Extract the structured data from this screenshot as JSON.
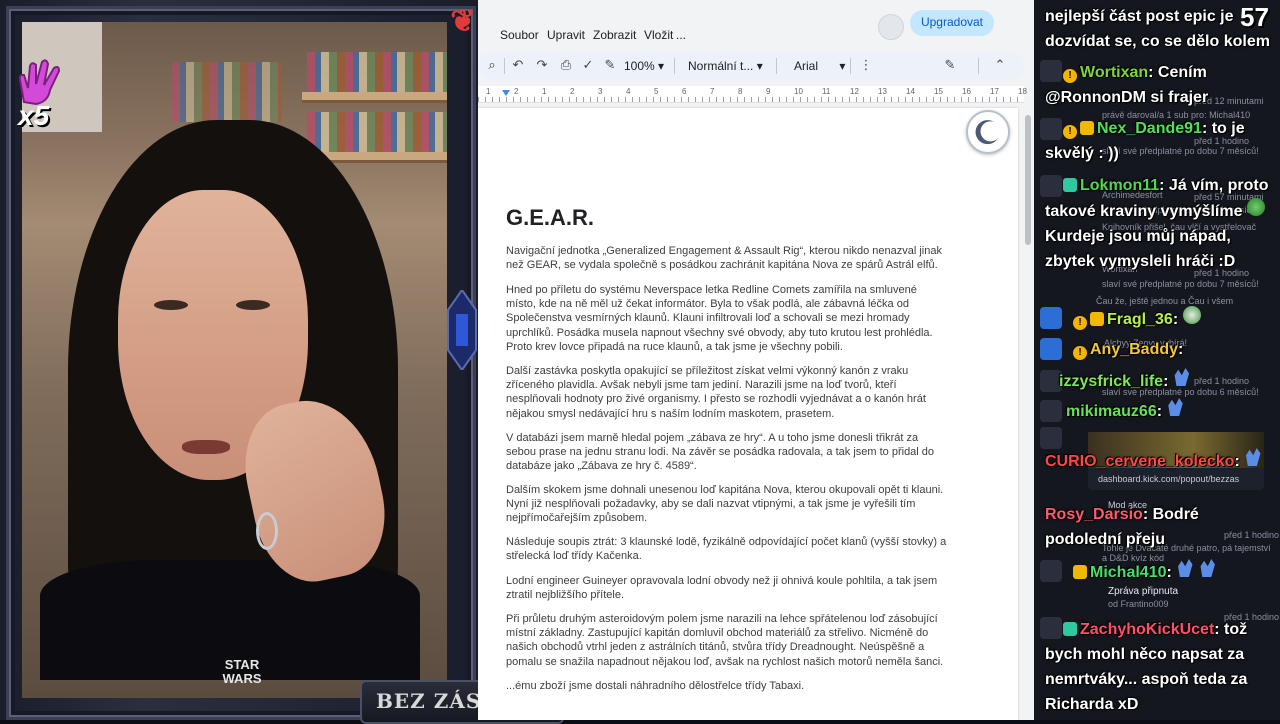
{
  "overlay": {
    "multiplier": "x5",
    "banner": "BEZ ZÁSTĚNY",
    "pendant_text": "STAR WARS",
    "viewer_count": "57"
  },
  "docs": {
    "menu": [
      "Soubor",
      "Upravit",
      "Zobrazit",
      "Vložit",
      "..."
    ],
    "upgrade_label": "Upgradovat",
    "zoom": "100%",
    "style": "Normální t...",
    "font": "Arial",
    "ruler_numbers": [
      "1",
      "2",
      "1",
      "2",
      "3",
      "4",
      "5",
      "6",
      "7",
      "8",
      "9",
      "10",
      "11",
      "12",
      "13",
      "14",
      "15",
      "16",
      "17",
      "18"
    ],
    "title": "G.E.A.R.",
    "paragraphs": [
      "Navigační jednotka „Generalized Engagement & Assault Rig“, kterou nikdo nenazval jinak než GEAR, se vydala společně s posádkou zachránit kapitána Nova ze spárů Astrál elfů.",
      "Hned po příletu do systému Neverspace letka Redline Comets zamířila na smluvené místo, kde na ně měl už čekat informátor. Byla to však podlá, ale zábavná léčka od Společenstva vesmírných klaunů. Klauni infiltrovali loď a schovali se mezi hromady uprchlíků. Posádka musela napnout všechny své obvody, aby tuto krutou lest prohlédla. Proto krev lovce připadá na ruce klaunů, a tak jsme je všechny pobili.",
      "Další zastávka poskytla opakující se příležitost získat velmi výkonný kanón z vraku zříceného plavidla. Avšak nebyli jsme tam jediní. Narazili jsme na loď tvorů, kteří nesplňovali hodnoty pro živé organismy. I přesto se rozhodli vyjednávat a o kanón hrát nějakou smysl nedávající hru s naším lodním maskotem, prasetem.",
      "V databázi jsem marně hledal pojem „zábava ze hry“. A u toho jsme donesli třikrát za sebou prase na jednu stranu lodi. Na závěr se posádka radovala, a tak jsem to přidal do databáze jako „Zábava ze hry č. 4589“.",
      "Dalším skokem jsme dohnali unesenou loď kapitána Nova, kterou okupovali opět ti klauni. Nyní již nesplňovali požadavky, aby se dali nazvat vtipnými, a tak jsme je vyřešili tím nejpřímočařejším způsobem.",
      "Následuje soupis ztrát: 3 klaunské lodě, fyzikálně odpovídající počet klanů (vyšší stovky) a střelecká loď třídy Kačenka.",
      "Lodní engineer Guineyer opravovala lodní obvody než ji ohnivá koule pohltila, a tak jsem ztratil nejbližšího přítele.",
      "Při průletu druhým asteroidovým polem jsme narazili na lehce spřátelenou loď zásobující místní základny. Zastupující kapitán domluvil obchod materiálů za střelivo. Nicméně do našich obchodů vtrhl jeden z astrálních titánů, stvůra třídy Dreadnought. Neúspěšně a pomalu se snažila napadnout nějakou loď, avšak na rychlost našich motorů neměla šanci.",
      "...ému zboží jsme dostali náhradního dělostřelce třídy Tabaxi."
    ]
  },
  "chat": {
    "messages": [
      {
        "user": "",
        "color": "#ffffff",
        "text": "nejlepší část post epic je dozvídat se, co se dělo kolem"
      },
      {
        "user": "Wortixan",
        "color": "#7cd63b",
        "text": ": Cením @RonnonDM si frajer"
      },
      {
        "user": "Nex_Dande91",
        "color": "#55e05c",
        "text": ": to je skvělý : ))"
      },
      {
        "user": "Lokmon11",
        "color": "#4fd94f",
        "text": ": Já vím, proto takové kraviny vymýšlíme"
      },
      {
        "user": "",
        "color": "#ffffff",
        "text": "Kurdeje jsou můj nápad, zbytek vymysleli hráči :D"
      },
      {
        "user": "Fragl_36",
        "color": "#b6f04a",
        "text": ":"
      },
      {
        "user": "Any_Baddy",
        "color": "#f0c842",
        "text": ":"
      },
      {
        "user": "izzysfrick_life",
        "color": "#7de85a",
        "text": ":"
      },
      {
        "user": "mikimauz66",
        "color": "#67e05a",
        "text": ":"
      },
      {
        "user": "CURIO_cervene_kolecko",
        "color": "#ff4747",
        "text": ":"
      },
      {
        "user": "Rosy_Darsio",
        "color": "#ff5a6e",
        "text": ": Bodré podolední přeju"
      },
      {
        "user": "Michal410",
        "color": "#49dd6a",
        "text": ":"
      },
      {
        "user": "ZachyhoKickUcet",
        "color": "#ff5068",
        "text": ": tož bych mohl něco napsat za nemrtváky... aspoň teda za Richarda xD"
      }
    ],
    "ghost": [
      "před 12 minutami",
      "právě daroval/a 1 sub pro: Michal410",
      "před 1 hodino",
      "slaví své předplatné po dobu 7 měsíců!",
      "Archimedesfort",
      "před 57 minutami",
      "slaví své předplatné po dobu 7 měsíců!",
      "Knihovník přišel, čau vlčí a vystřelovač",
      "Wortixan",
      "před 1 hodino",
      "slaví své předplatné po dobu 7 měsíců!",
      "Čau že, ještě jednou a Čau i všem",
      "Alchyy Zeovy vybírá!",
      "před 1 hodino",
      "slaví své předplatné po dobu 6 měsíců!",
      "dashboard.kick.com/popout/bezzas",
      "Mod akce",
      "před 1 hodino",
      "Tohle je Dvacáté druhé patro, pá tajemství a D&D kvíz kód",
      "Zpráva připnuta",
      "od Frantino009",
      "před 1 hodino"
    ]
  }
}
